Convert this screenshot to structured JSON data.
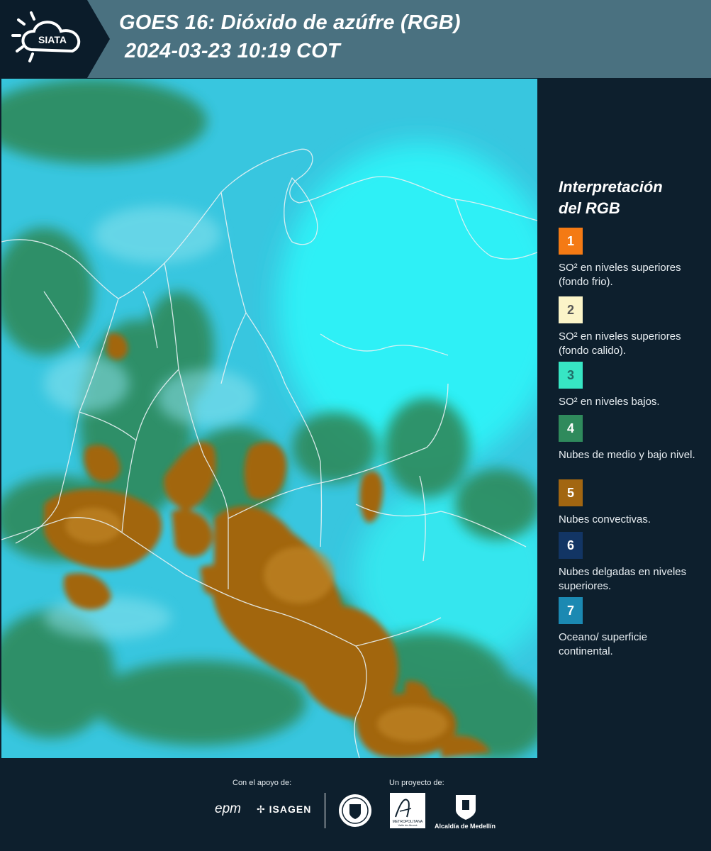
{
  "header": {
    "logo_text": "SIATA",
    "title_line1": "GOES 16: Dióxido de azúfre (RGB)",
    "title_line2": "2024-03-23 10:19 COT"
  },
  "legend": {
    "title_line1": "Interpretación",
    "title_line2": "del RGB",
    "items": [
      {
        "number": "1",
        "color": "#f47a14",
        "text": "SO² en niveles superiores (fondo frio)."
      },
      {
        "number": "2",
        "color": "#fbf4c8",
        "text": "SO² en niveles superiores (fondo calido)."
      },
      {
        "number": "3",
        "color": "#37e6c4",
        "text": "SO² en niveles bajos."
      },
      {
        "number": "4",
        "color": "#2f8a5c",
        "text": "Nubes de medio y bajo nivel."
      },
      {
        "number": "5",
        "color": "#a26611",
        "text": "Nubes convectivas."
      },
      {
        "number": "6",
        "color": "#123564",
        "text": "Nubes delgadas en niveles superiores."
      },
      {
        "number": "7",
        "color": "#1b89b2",
        "text": "Oceano/ superficie continental."
      }
    ]
  },
  "footer": {
    "support_label": "Con el apoyo de:",
    "project_label": "Un proyecto de:",
    "sponsors": [
      "epm",
      "ISAGEN"
    ],
    "partners": [
      "Área Metropolitana Valle de Aburrá",
      "Alcaldía de Medellín"
    ],
    "caption_area": "METROPOLITANA",
    "caption_area_sub": "Valle de Aburrá",
    "caption_alcaldia": "Alcaldía de Medellín"
  },
  "colors": {
    "ocean_cyan": "#38c6df",
    "convective_brown": "#a26611",
    "mid_cloud_green": "#2f8a5c",
    "header_bg": "#4a7180",
    "panel_bg": "#0d1f2d"
  }
}
